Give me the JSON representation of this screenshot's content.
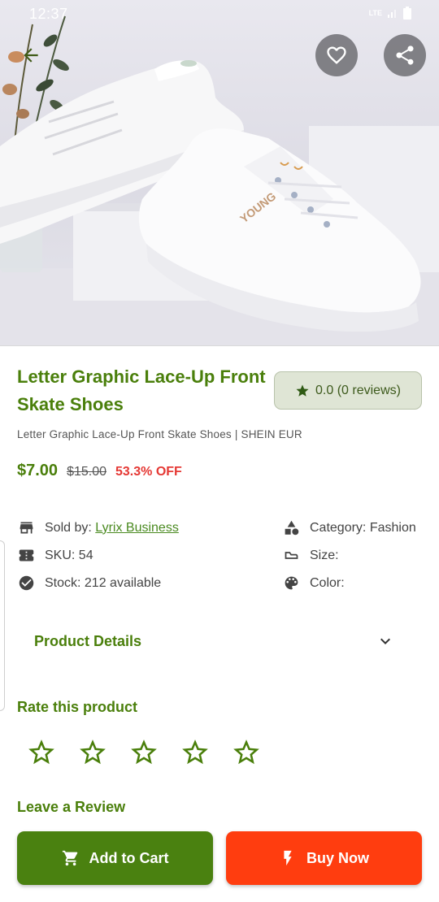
{
  "status_bar": {
    "time": "12:37",
    "network": "LTE"
  },
  "colors": {
    "primary": "#4a7f0b",
    "buy_now": "#ff3d0f",
    "discount": "#e53935",
    "rating_chip_bg": "#dfe5d5"
  },
  "hero": {
    "image_subject": "white lace-up skate shoes",
    "shoe_text": "YOUNG",
    "icons": {
      "back": "arrow-left-icon",
      "favorite": "heart-outline-icon",
      "share": "share-icon"
    }
  },
  "product": {
    "title": "Letter Graphic Lace-Up Front Skate Shoes",
    "subtitle": "Letter Graphic Lace-Up Front Skate Shoes | SHEIN EUR",
    "rating": "0.0 (0 reviews)",
    "price": "$7.00",
    "old_price": "$15.00",
    "discount": "53.3% OFF"
  },
  "info": {
    "sold_by_label": "Sold by:",
    "seller": "Lyrix Business",
    "sku": "SKU: 54",
    "stock": "Stock: 212 available",
    "category": "Category: Fashion",
    "size": "Size:",
    "color": "Color:"
  },
  "details": {
    "label": "Product Details"
  },
  "rate": {
    "heading": "Rate this product",
    "stars": 5,
    "selected": 0
  },
  "review": {
    "heading": "Leave a Review"
  },
  "actions": {
    "add_to_cart": "Add to Cart",
    "buy_now": "Buy Now"
  }
}
